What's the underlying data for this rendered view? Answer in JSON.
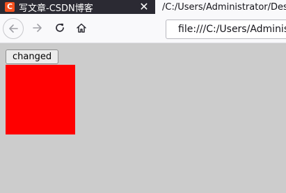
{
  "browser": {
    "tabs": [
      {
        "title": "写文章-CSDN博客",
        "favicon": "C",
        "favicon_color": "#f4511e",
        "close_label": "✕"
      },
      {
        "title": "/C:/Users/Administrator/Desktop"
      }
    ],
    "nav": {
      "back_icon": "back-arrow-icon",
      "forward_icon": "forward-arrow-icon",
      "reload_icon": "reload-icon",
      "home_icon": "home-icon"
    },
    "address_bar": {
      "url": "file:///C:/Users/Administrator/Desktop",
      "page_icon": "page-icon"
    }
  },
  "page": {
    "button_label": "changed",
    "box_color": "#ff0000",
    "background_color": "#cccccc"
  }
}
